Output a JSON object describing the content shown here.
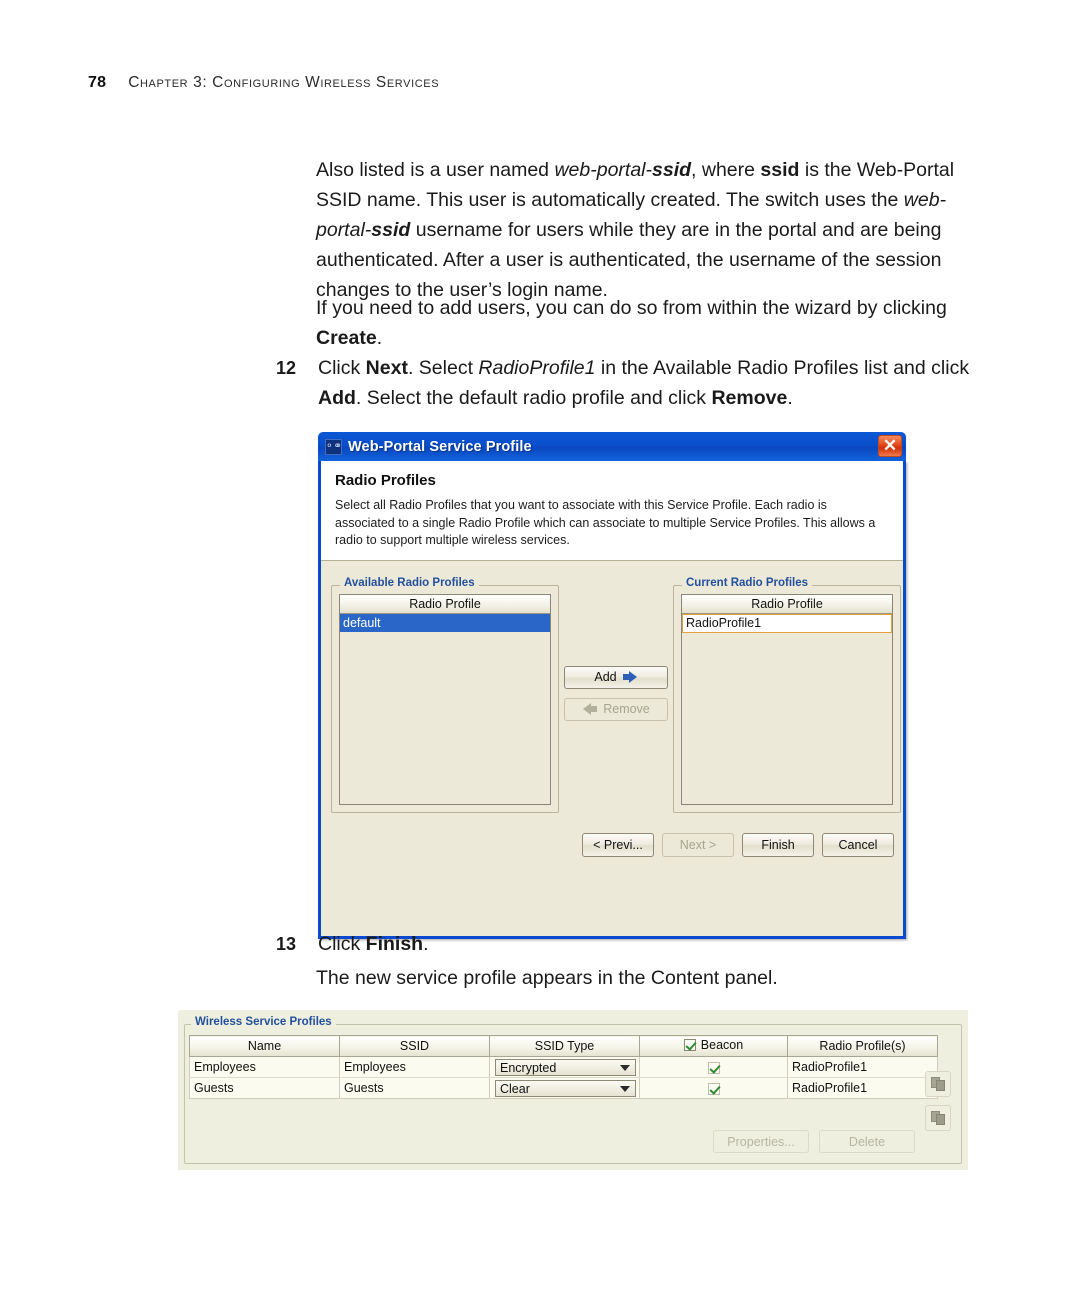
{
  "header": {
    "page_number": "78",
    "chapter_title": "Chapter 3: Configuring Wireless Services"
  },
  "body": {
    "para_intro": {
      "t1": "Also listed is a user named ",
      "i1": "web-portal-",
      "bi1": "ssid",
      "t2": ", where ",
      "b1": "ssid",
      "t3": " is the Web-Portal SSID name. This user is automatically created. The switch uses the ",
      "i2": "web-portal-",
      "bi2": "ssid",
      "t4": " username for users while they are in the portal and are being authenticated. After a user is authenticated, the username of the session changes to the user’s login name."
    },
    "para_create": {
      "t1": "If you need to add users, you can do so from within the wizard by clicking ",
      "b1": "Create",
      "t2": "."
    },
    "step_12": {
      "number": "12",
      "t1": "Click ",
      "b1": "Next",
      "t2": ". Select ",
      "i1": "RadioProfile1",
      "t3": " in the Available Radio Profiles list and click ",
      "b2": "Add",
      "t4": ". Select the default radio profile and click ",
      "b3": "Remove",
      "t5": "."
    },
    "step_13": {
      "number": "13",
      "t1": "Click ",
      "b1": "Finish",
      "t2": "."
    },
    "para_content_panel": "The new service profile appears in the Content panel."
  },
  "dialog": {
    "title": "Web-Portal Service Profile",
    "icon": "wireless-key-icon",
    "close_label": "✕",
    "heading": "Radio Profiles",
    "description": "Select all Radio Profiles that you want to associate with this Service Profile. Each radio is associated to a single Radio Profile which can associate to multiple Service Profiles. This allows a radio to support multiple wireless services.",
    "available_group_label": "Available Radio Profiles",
    "current_group_label": "Current Radio Profiles",
    "column_header": "Radio Profile",
    "available_items": [
      {
        "label": "default",
        "state": "selected"
      }
    ],
    "current_items": [
      {
        "label": "RadioProfile1",
        "state": "focused"
      }
    ],
    "add_label": "Add",
    "remove_label": "Remove",
    "remove_enabled": false,
    "footer_buttons": [
      {
        "label": "< Previ...",
        "enabled": true
      },
      {
        "label": "Next >",
        "enabled": false
      },
      {
        "label": "Finish",
        "enabled": true
      },
      {
        "label": "Cancel",
        "enabled": true
      }
    ],
    "colors": {
      "titlebar_blue": "#0a4ecb",
      "frame_blue": "#0a4ad0",
      "body_beige": "#ece9d8",
      "selection_blue": "#2a66c8",
      "focus_orange": "#e2a03f",
      "group_label_blue": "#23509e",
      "close_red": "#e2481a"
    }
  },
  "content_panel": {
    "group_label": "Wireless Service Profiles",
    "columns": [
      "Name",
      "SSID",
      "SSID Type",
      "Beacon",
      "Radio Profile(s)"
    ],
    "beacon_header_checked": true,
    "rows": [
      {
        "name": "Employees",
        "ssid": "Employees",
        "ssid_type": "Encrypted",
        "beacon": true,
        "radio_profiles": "RadioProfile1"
      },
      {
        "name": "Guests",
        "ssid": "Guests",
        "ssid_type": "Clear",
        "beacon": true,
        "radio_profiles": "RadioProfile1"
      }
    ],
    "side_buttons": [
      {
        "icon": "copy-icon"
      },
      {
        "icon": "paste-icon"
      }
    ],
    "footer_buttons": [
      {
        "label": "Properties...",
        "enabled": false
      },
      {
        "label": "Delete",
        "enabled": false
      }
    ],
    "colors": {
      "panel_bg": "#eeefdf",
      "row_bg": "#fbfbf0",
      "check_green": "#2e8b30",
      "label_blue": "#23509e"
    }
  }
}
